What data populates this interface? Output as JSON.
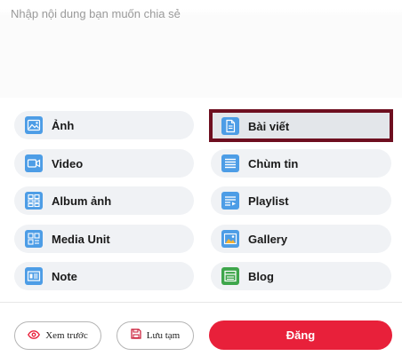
{
  "composer": {
    "placeholder": "Nhập nội dung bạn muốn chia sẻ"
  },
  "post_types": {
    "left": [
      {
        "label": "Ảnh",
        "icon": "image-icon"
      },
      {
        "label": "Video",
        "icon": "video-camera-icon"
      },
      {
        "label": "Album ảnh",
        "icon": "album-icon"
      },
      {
        "label": "Media Unit",
        "icon": "media-unit-icon"
      },
      {
        "label": "Note",
        "icon": "note-icon"
      }
    ],
    "right": [
      {
        "label": "Bài viết",
        "icon": "document-icon",
        "selected": true
      },
      {
        "label": "Chùm tin",
        "icon": "news-cluster-icon"
      },
      {
        "label": "Playlist",
        "icon": "playlist-icon"
      },
      {
        "label": "Gallery",
        "icon": "gallery-icon"
      },
      {
        "label": "Blog",
        "icon": "blog-icon"
      }
    ]
  },
  "actions": {
    "preview_label": "Xem trước",
    "preview_icon": "eye-icon",
    "draft_label": "Lưu tạm",
    "draft_icon": "save-icon",
    "post_label": "Đăng"
  },
  "colors": {
    "icon_blue": "#4d9de6",
    "icon_green": "#3ea64b",
    "post_red": "#e8203a",
    "selection_frame": "#6e0f20",
    "eye_red": "#e8203a",
    "draft_red": "#c8102e"
  }
}
